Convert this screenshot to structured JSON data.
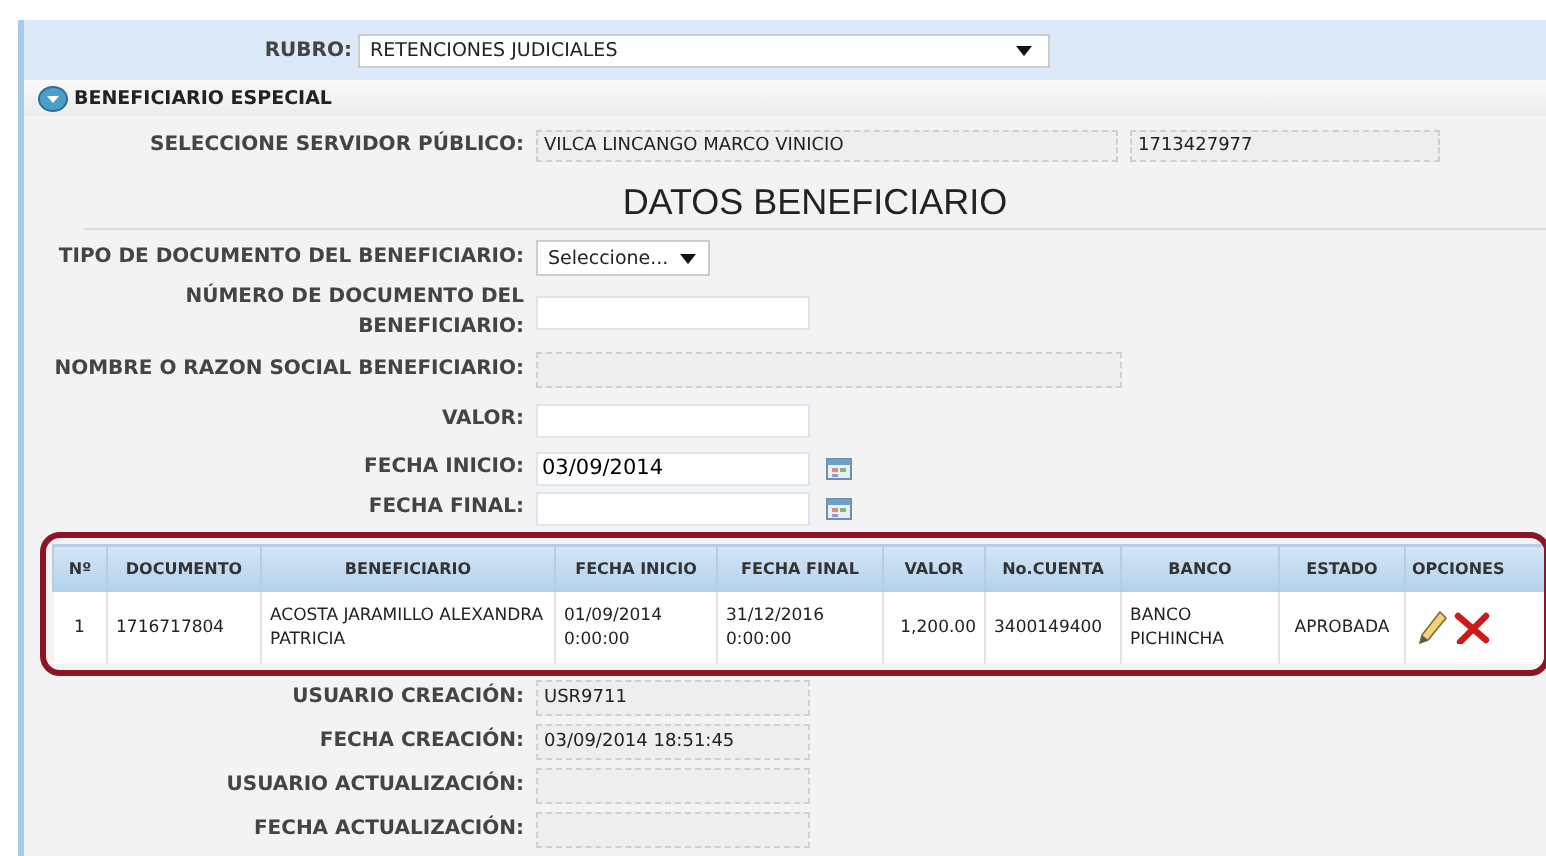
{
  "rubro": {
    "label": "RUBRO:",
    "value": "RETENCIONES JUDICIALES"
  },
  "section": {
    "title": "BENEFICIARIO ESPECIAL",
    "expanded": true
  },
  "servidor": {
    "label": "SELECCIONE SERVIDOR PÚBLICO:",
    "name": "VILCA LINCANGO MARCO VINICIO",
    "id": "1713427977"
  },
  "title": "DATOS BENEFICIARIO",
  "fields": [
    {
      "kind": "select",
      "label": "TIPO DE DOCUMENTO DEL BENEFICIARIO:",
      "value": "Seleccione..."
    },
    {
      "kind": "text",
      "label": "NÚMERO DE DOCUMENTO DEL BENEFICIARIO:"
    },
    {
      "kind": "readonly",
      "label": "NOMBRE O RAZON SOCIAL BENEFICIARIO:"
    },
    {
      "kind": "text",
      "label": "VALOR:"
    },
    {
      "kind": "date",
      "label": "FECHA INICIO:",
      "value": "03/09/2014"
    },
    {
      "kind": "date",
      "label": "FECHA FINAL:"
    }
  ],
  "table": {
    "columns": [
      "Nº",
      "DOCUMENTO",
      "BENEFICIARIO",
      "FECHA INICIO",
      "FECHA FINAL",
      "VALOR",
      "No.CUENTA",
      "BANCO",
      "ESTADO",
      "OPCIONES"
    ],
    "rows": [
      {
        "cells": [
          "1",
          "1716717804",
          "ACOSTA JARAMILLO ALEXANDRA PATRICIA",
          "01/09/2014 0:00:00",
          "31/12/2016 0:00:00",
          "1,200.00",
          "3400149400",
          "BANCO PICHINCHA",
          "APROBADA"
        ]
      }
    ]
  },
  "audit": [
    {
      "label": "USUARIO CREACIÓN:",
      "value": "USR9711"
    },
    {
      "label": "FECHA CREACIÓN:",
      "value": "03/09/2014 18:51:45"
    },
    {
      "label": "USUARIO ACTUALIZACIÓN:"
    },
    {
      "label": "FECHA ACTUALIZACIÓN:"
    }
  ]
}
